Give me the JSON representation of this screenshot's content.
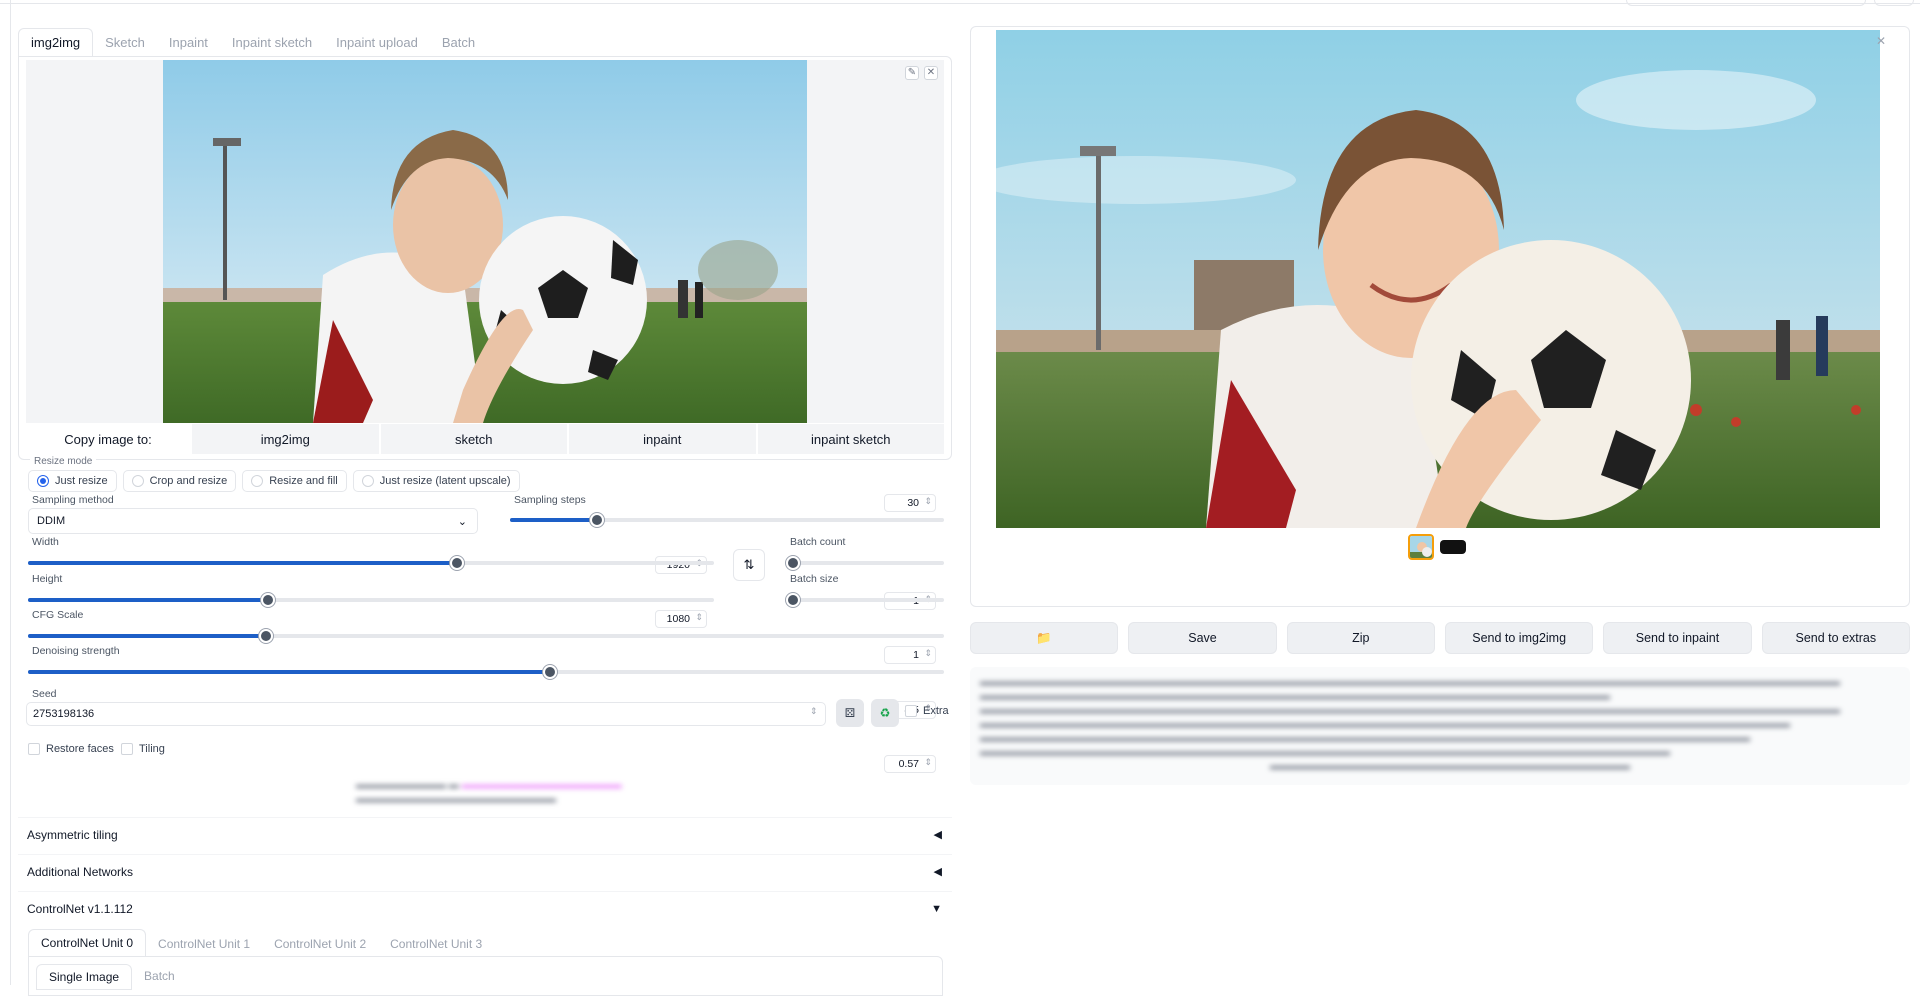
{
  "tabs": [
    "img2img",
    "Sketch",
    "Inpaint",
    "Inpaint sketch",
    "Inpaint upload",
    "Batch"
  ],
  "active_tab": "img2img",
  "source_tools": {
    "edit_icon": "pencil-icon",
    "close_icon": "close-icon",
    "edit": "✎",
    "close": "✕"
  },
  "copy_image": {
    "label": "Copy image to:",
    "buttons": [
      "img2img",
      "sketch",
      "inpaint",
      "inpaint sketch"
    ]
  },
  "resize_mode": {
    "legend": "Resize mode",
    "options": [
      "Just resize",
      "Crop and resize",
      "Resize and fill",
      "Just resize (latent upscale)"
    ],
    "selected": "Just resize"
  },
  "sampling_method": {
    "label": "Sampling method",
    "value": "DDIM"
  },
  "sampling_steps": {
    "label": "Sampling steps",
    "value": "30",
    "fraction": 0.2
  },
  "width": {
    "label": "Width",
    "value": "1920",
    "fraction": 0.625
  },
  "height": {
    "label": "Height",
    "value": "1080",
    "fraction": 0.35
  },
  "swap_button": {
    "icon": "swap-icon",
    "glyph": "⇅"
  },
  "batch_count": {
    "label": "Batch count",
    "value": "1",
    "fraction": 0
  },
  "batch_size": {
    "label": "Batch size",
    "value": "1",
    "fraction": 0
  },
  "cfg_scale": {
    "label": "CFG Scale",
    "value": "8.5",
    "fraction": 0.26
  },
  "denoising": {
    "label": "Denoising strength",
    "value": "0.57",
    "fraction": 0.57
  },
  "seed": {
    "label": "Seed",
    "value": "2753198136",
    "dice_icon": "dice-icon",
    "recycle_icon": "recycle-icon",
    "dice": "⚄",
    "recycle": "♻",
    "extra_label": "Extra"
  },
  "options": {
    "restore_faces": "Restore faces",
    "tiling": "Tiling"
  },
  "accordions": [
    {
      "title": "Asymmetric tiling",
      "state": "◀"
    },
    {
      "title": "Additional Networks",
      "state": "◀"
    },
    {
      "title": "ControlNet v1.1.112",
      "state": "▼"
    }
  ],
  "controlnet": {
    "units": [
      "ControlNet Unit 0",
      "ControlNet Unit 1",
      "ControlNet Unit 2",
      "ControlNet Unit 3"
    ],
    "active_unit": "ControlNet Unit 0",
    "subtabs": [
      "Single Image",
      "Batch"
    ]
  },
  "output": {
    "close_glyph": "✕",
    "buttons": [
      "",
      "Save",
      "Zip",
      "Send to img2img",
      "Send to inpaint",
      "Send to extras"
    ],
    "folder_icon": "folder-icon",
    "folder_glyph": "📁"
  },
  "colors": {
    "accent": "#1d5fc7",
    "knob": "#4b5563",
    "border": "#e5e7eb"
  }
}
